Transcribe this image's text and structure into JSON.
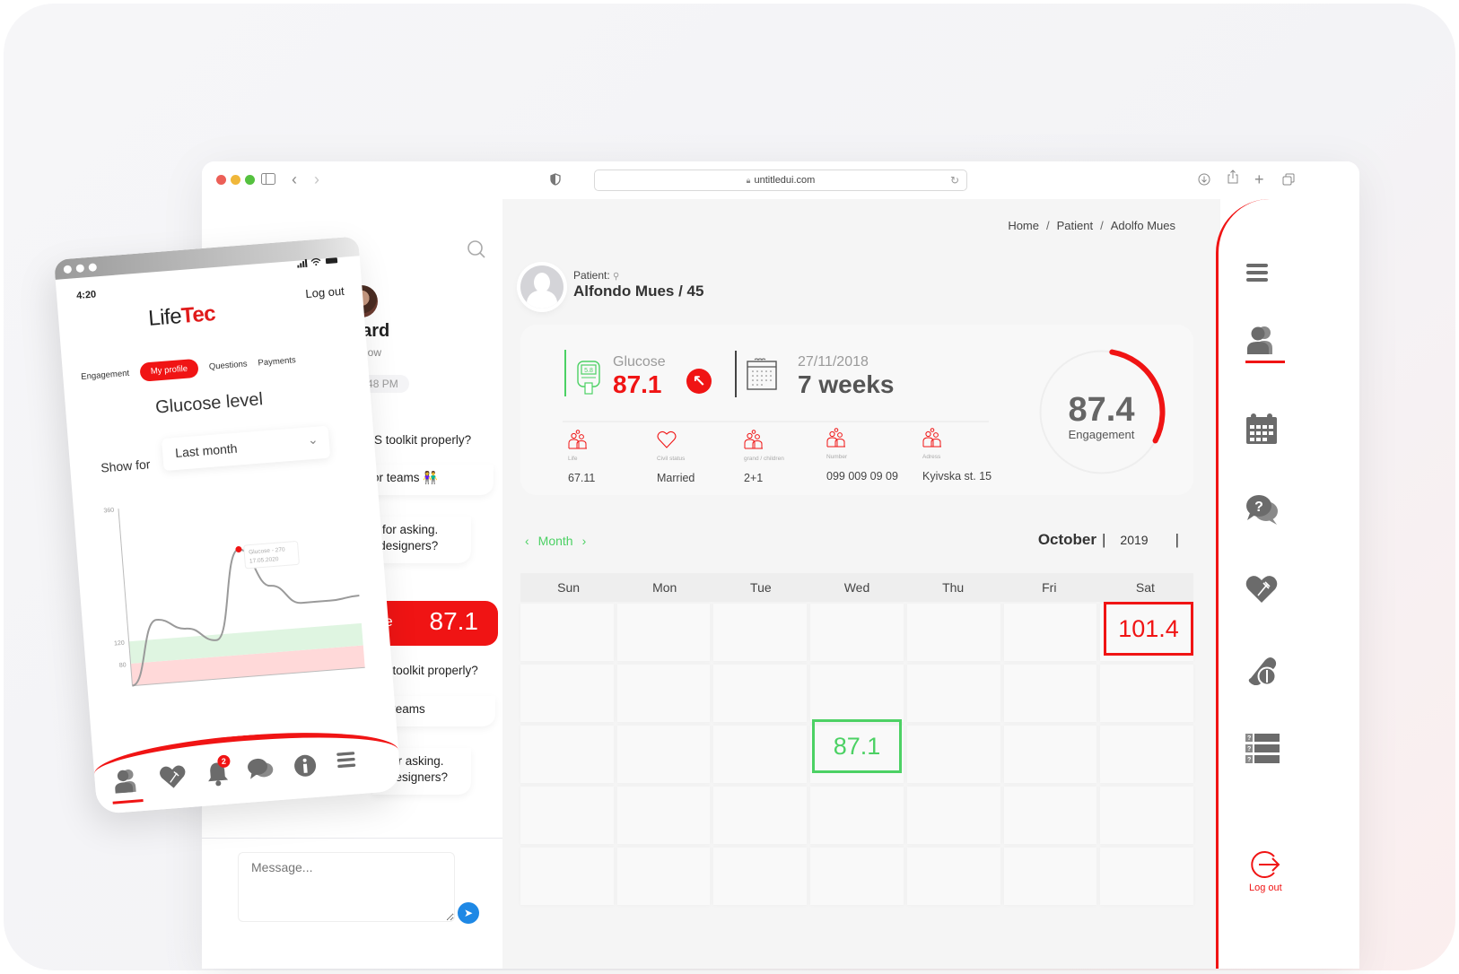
{
  "browser": {
    "url": "untitledui.com",
    "icons": [
      "sidebar-icon",
      "back-icon",
      "forward-icon",
      "shield-icon",
      "download-icon",
      "share-icon",
      "new-tab-icon",
      "tabs-icon"
    ]
  },
  "chat": {
    "contact_name": "Edward",
    "contact_status": "Active now",
    "timestamp": "UE · 14:48 PM",
    "messages": [
      "to use iOS toolkit properly?",
      "ecially for teams 👫",
      ", thanks for asking.\nv many designers?",
      "e iOS toolkit properly?",
      "y for teams",
      "ks for asking.\nny designers?"
    ],
    "glucose_bubble": {
      "label": "t glicose",
      "value": "87.1"
    },
    "message_placeholder": "Message..."
  },
  "dashboard": {
    "breadcrumb": [
      "Home",
      "Patient",
      "Adolfo Mues"
    ],
    "patient_label": "Patient:",
    "patient_name": "Alfondo Mues / 45",
    "glucose": {
      "label": "Glucose",
      "value": "87.1",
      "meter_reading": "5.8",
      "trend": "up"
    },
    "since": {
      "date": "27/11/2018",
      "duration": "7 weeks"
    },
    "info": [
      {
        "caption": "Life",
        "value": "67.11",
        "icon": "family-icon"
      },
      {
        "caption": "Civil status",
        "value": "Married",
        "icon": "heart-icon"
      },
      {
        "caption": "grand / children",
        "value": "2+1",
        "icon": "family-icon"
      },
      {
        "caption": "Number",
        "value": "099 009 09 09",
        "icon": "family-icon"
      },
      {
        "caption": "Adress",
        "value": "Kyivska st. 15",
        "icon": "family-icon"
      }
    ],
    "engagement": {
      "value": "87.4",
      "label": "Engagement",
      "progress_fraction": 0.3,
      "color": "#f01414"
    },
    "calendar": {
      "view_label": "Month",
      "month": "October",
      "year": "2019",
      "weekdays": [
        "Sun",
        "Mon",
        "Tue",
        "Wed",
        "Thu",
        "Fri",
        "Sat"
      ],
      "readings": [
        {
          "week": 1,
          "day": "Sat",
          "value": "101.4",
          "status": "high",
          "color": "#f01414"
        },
        {
          "week": 3,
          "day": "Wed",
          "value": "87.1",
          "status": "normal",
          "color": "#4cd164"
        }
      ]
    }
  },
  "right_nav": {
    "items": [
      "menu-icon",
      "patients-icon",
      "calendar-icon",
      "questions-icon",
      "nutrition-icon",
      "medication-icon",
      "questionnaire-icon"
    ],
    "active": "patients-icon",
    "logout_label": "Log out"
  },
  "phone": {
    "time": "4:20",
    "logo_light": "Life",
    "logo_bold": "Tec",
    "logout": "Log out",
    "tabs": [
      "Engagement",
      "My profile",
      "Questions",
      "Payments"
    ],
    "active_tab": "My profile",
    "title": "Glucose level",
    "show_for_label": "Show for",
    "show_for_value": "Last month",
    "notification_count": "2",
    "nav_icons": [
      "patients-icon",
      "nutrition-icon",
      "bell-icon",
      "chat-icon",
      "info-icon",
      "menu-icon"
    ]
  },
  "chart_data": {
    "type": "line",
    "title": "Glucose level",
    "xlabel": "",
    "ylabel": "",
    "yticks": [
      80,
      120,
      360
    ],
    "ylim": [
      40,
      360
    ],
    "x": [
      0,
      1,
      2,
      3,
      4,
      5,
      6,
      7,
      8
    ],
    "series": [
      {
        "name": "Glucose",
        "values": [
          40,
          155,
          135,
          110,
          270,
          200,
          165,
          165,
          170
        ]
      }
    ],
    "bands": [
      {
        "name": "low",
        "from": 40,
        "to": 80,
        "color": "#ffd9d9"
      },
      {
        "name": "target",
        "from": 80,
        "to": 120,
        "color": "#dff5e1"
      }
    ],
    "tooltip": {
      "label": "Glucose - 270",
      "date": "17.05.2020",
      "point_index": 4
    }
  }
}
